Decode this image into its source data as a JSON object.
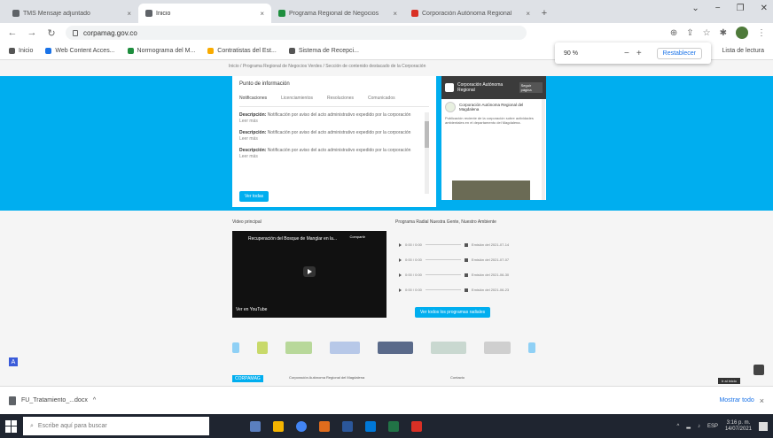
{
  "browser": {
    "tabs": [
      {
        "title": "TMS Mensaje adjuntado",
        "favicon": "gray"
      },
      {
        "title": "Inicio",
        "favicon": "gray",
        "active": true
      },
      {
        "title": "Programa Regional de Negocios",
        "favicon": "green"
      },
      {
        "title": "Corporación Autónoma Regional",
        "favicon": "red"
      }
    ],
    "new_tab_symbol": "+",
    "url": "corpamag.gov.co",
    "bookmarks": [
      {
        "label": "Inicio"
      },
      {
        "label": "Web Content Acces..."
      },
      {
        "label": "Normograma del M..."
      },
      {
        "label": "Contratistas del Est..."
      },
      {
        "label": "Sistema de Recepci..."
      }
    ],
    "other_bookmarks": "Lista de lectura",
    "zoom": {
      "level": "90 %",
      "minus": "−",
      "plus": "+",
      "reset_label": "Restablecer"
    }
  },
  "page": {
    "breadcrumbs": "Inicio / Programa Regional de Negocios Verdes / Sección de contenido destacado de la Corporación",
    "info_panel": {
      "title": "Punto de información",
      "tabs": [
        "Notificaciones",
        "Licenciamientos",
        "Resoluciones",
        "Comunicados"
      ],
      "items": [
        {
          "label": "Descripción:",
          "text": "Notificación por aviso del acto administrativo expedido por la corporación",
          "more": "Leer más"
        },
        {
          "label": "Descripción:",
          "text": "Notificación por aviso del acto administrativo expedido por la corporación",
          "more": "Leer más"
        },
        {
          "label": "Descripción:",
          "text": "Notificación por aviso del acto administrativo expedido por la corporación",
          "more": "Leer más"
        }
      ],
      "button": "Ver todas"
    },
    "facebook": {
      "header_title": "Corporación Autónoma Regional",
      "follow": "Seguir página",
      "page_name": "Corporación Autónoma Regional del Magdalena",
      "post_text": "Publicación reciente de la corporación sobre actividades ambientales en el departamento del Magdalena."
    },
    "video_label": "Video principal",
    "video": {
      "title": "Recuperación del Bosque de Manglar en la...",
      "share": "Compartir",
      "brand": "Ver en YouTube"
    },
    "audio_label": "Programa Radial Nuestra Gente, Nuestro Ambiente",
    "audio_items": [
      {
        "time": "0:00 / 0:00",
        "caption": "Emisión del 2021-07-14"
      },
      {
        "time": "0:00 / 0:00",
        "caption": "Emisión del 2021-07-07"
      },
      {
        "time": "0:00 / 0:00",
        "caption": "Emisión del 2021-06-30"
      },
      {
        "time": "0:00 / 0:00",
        "caption": "Emisión del 2021-06-23"
      }
    ],
    "audio_button": "Ver todos los programas radiales",
    "footer": {
      "logo_text": "CORPAMAG",
      "org": "Corporación Autónoma Regional del Magdalena",
      "contact": "Contacto"
    },
    "accessibility": "A",
    "go_top": "Ir al inicio"
  },
  "downloads": {
    "file": "FU_Tratamiento_...docx",
    "caret": "^",
    "show_all": "Mostrar todo",
    "close": "×"
  },
  "taskbar": {
    "search_placeholder": "Escribe aquí para buscar",
    "time": "3:16 p. m.",
    "date": "14/07/2021",
    "lang": "ESP"
  }
}
